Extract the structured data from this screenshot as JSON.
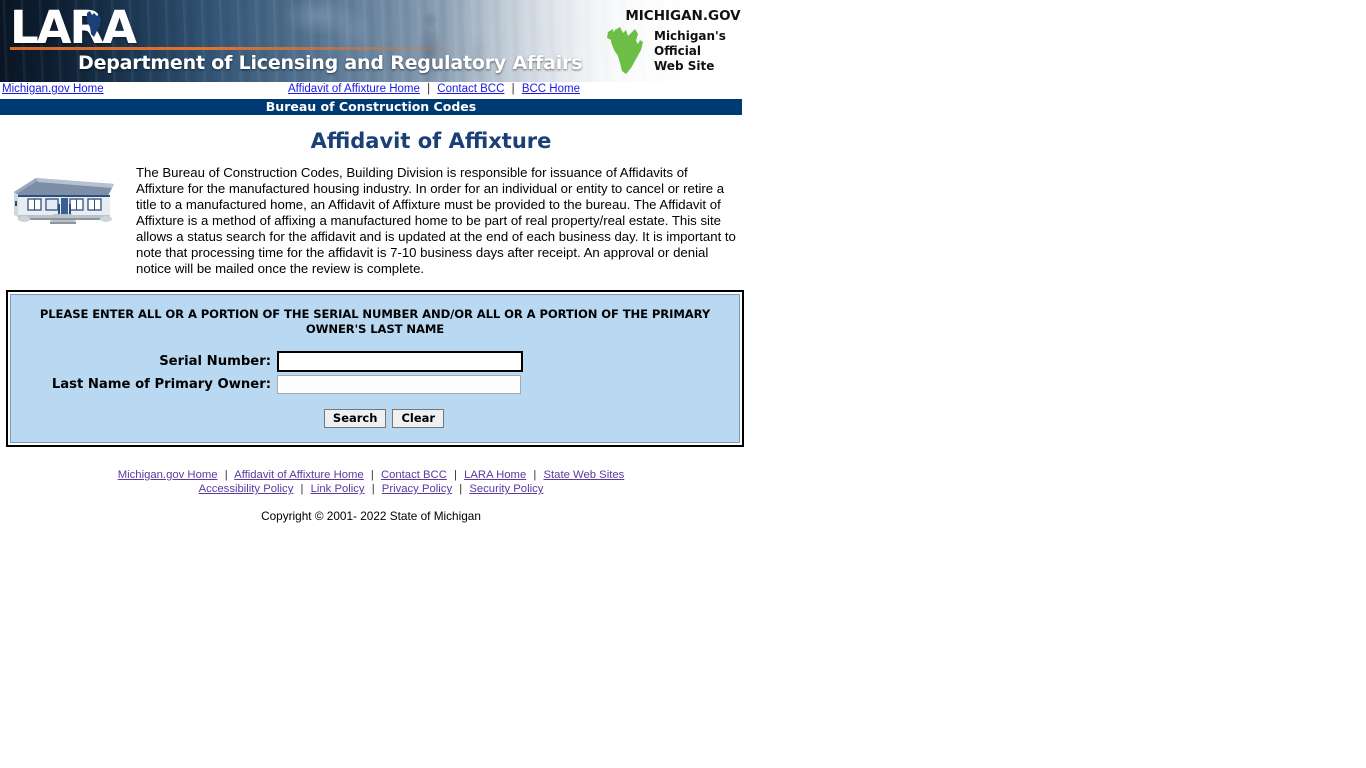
{
  "banner": {
    "logo_text": "LARA",
    "department_line": "Department of Licensing and Regulatory Affairs",
    "migov_title": "MICHIGAN.GOV",
    "migov_line1": "Michigan's",
    "migov_line2": "Official",
    "migov_line3": "Web  Site",
    "accent_orange": "#e0742e",
    "banner_dark": "#0a1a2b",
    "mitten_green": "#6cbe45"
  },
  "topnav": {
    "left_link": "Michigan.gov Home",
    "center_links": [
      "Affidavit of Affixture Home",
      "Contact BCC",
      "BCC Home"
    ],
    "separator": "|",
    "link_color": "#1a1ae0"
  },
  "titlebar": {
    "text": "Bureau of Construction Codes",
    "bg_color": "#003a72"
  },
  "content": {
    "heading": "Affidavit of Affixture",
    "heading_color": "#1b3f77",
    "intro_paragraph": "The Bureau of Construction Codes, Building Division is responsible for issuance of Affidavits of Affixture for the manufactured housing industry.  In order for an individual or entity to cancel or retire a title to a manufactured home, an Affidavit of Affixture must be provided to the bureau.  The Affidavit of Affixture is a method of affixing a manufactured home to be part of real property/real estate.  This site allows a status search for the affidavit and is updated at the end of each business day.  It is important to note that processing time for the affidavit is 7-10 business days after receipt.  An approval or denial notice will be mailed once the review is complete.",
    "house_image_alt": "manufactured home"
  },
  "search_form": {
    "prompt": "PLEASE ENTER ALL OR A PORTION OF THE SERIAL NUMBER AND/OR ALL OR A PORTION OF THE PRIMARY OWNER'S LAST NAME",
    "serial_label": "Serial Number:",
    "serial_value": "",
    "serial_placeholder": "",
    "lastname_label": "Last Name of Primary Owner:",
    "lastname_value": "",
    "lastname_placeholder": "",
    "search_button": "Search",
    "clear_button": "Clear",
    "box_bg_color": "#b9d9f2"
  },
  "footer": {
    "row1": [
      "Michigan.gov Home",
      "Affidavit of Affixture Home",
      "Contact BCC",
      "LARA Home",
      "State Web Sites"
    ],
    "row2": [
      "Accessibility Policy",
      "Link Policy",
      "Privacy Policy",
      "Security Policy"
    ],
    "separator": "|",
    "copyright": "Copyright © 2001- 2022 State of Michigan",
    "link_color": "#5a3a9e"
  }
}
